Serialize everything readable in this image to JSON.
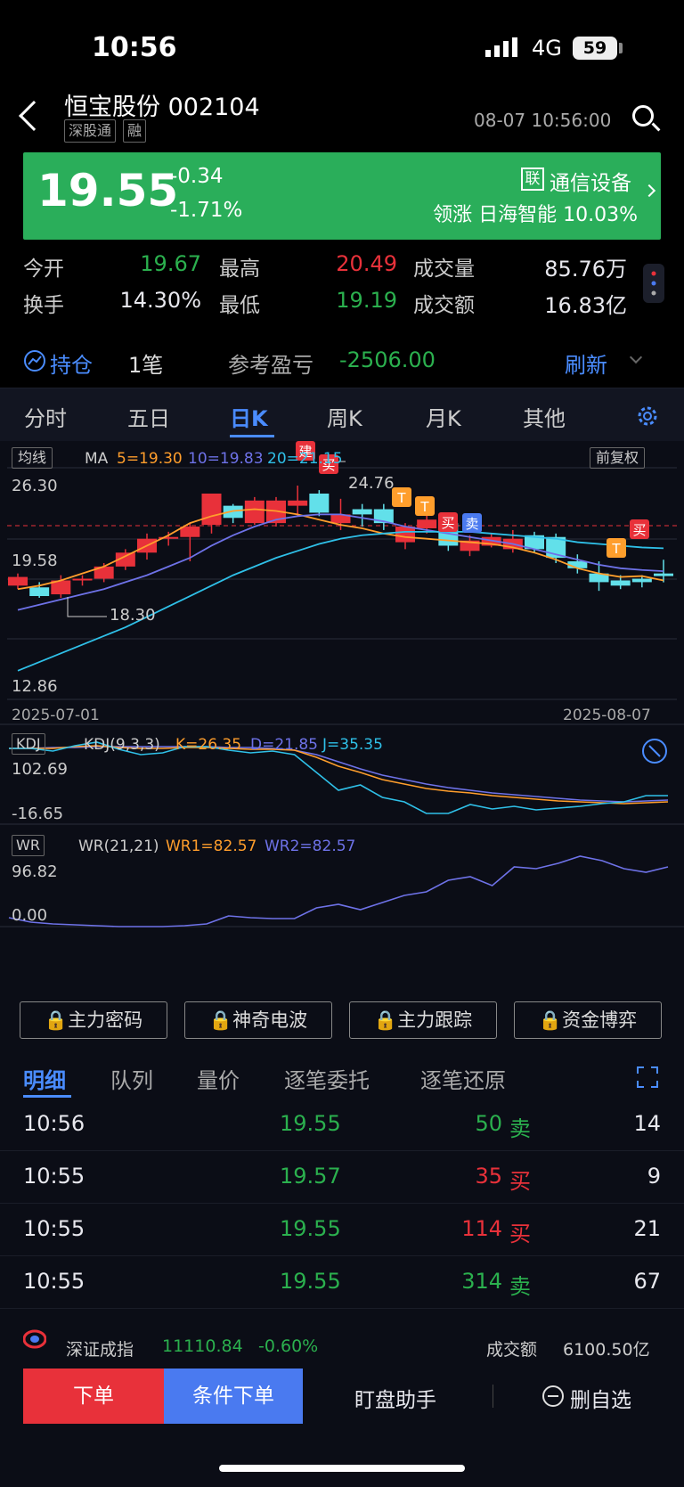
{
  "status": {
    "time": "10:56",
    "network": "4G",
    "battery": "59"
  },
  "header": {
    "name": "恒宝股份 002104",
    "tags": [
      "深股通",
      "融"
    ],
    "datetime": "08-07 10:56:00"
  },
  "quote": {
    "price": "19.55",
    "change": "-0.34",
    "change_pct": "-1.71%",
    "industry_tag": "联",
    "industry": "通信设备",
    "leader": "领涨 日海智能 10.03%",
    "bg_color": "#2aae5a"
  },
  "stats": [
    {
      "label": "今开",
      "value": "19.67",
      "color": "green"
    },
    {
      "label": "最高",
      "value": "20.49",
      "color": "red"
    },
    {
      "label": "成交量",
      "value": "85.76万",
      "color": "white"
    },
    {
      "label": "换手",
      "value": "14.30%",
      "color": "white"
    },
    {
      "label": "最低",
      "value": "19.19",
      "color": "green"
    },
    {
      "label": "成交额",
      "value": "16.83亿",
      "color": "white"
    }
  ],
  "holding": {
    "label": "持仓",
    "count": "1笔",
    "ref_label": "参考盈亏",
    "ref_value": "-2506.00",
    "refresh": "刷新"
  },
  "tabs": [
    "分时",
    "五日",
    "日K",
    "周K",
    "月K",
    "其他"
  ],
  "active_tab": "日K",
  "chart": {
    "ma_selector": "均线",
    "adjust": "前复权",
    "ma_label": "MA",
    "ma5": "5=19.30",
    "ma10": "10=19.83",
    "ma20": "20=21.15",
    "y_top": "26.30",
    "y_mid": "19.58",
    "y_bottom": "12.86",
    "high_mark": "24.76",
    "low_mark": "18.30",
    "x_start": "2025-07-01",
    "x_end": "2025-08-07",
    "kdj_selector": "KDJ",
    "kdj_params": "KDJ(9,3,3)",
    "k": "K=26.35",
    "d": "D=21.85",
    "j": "J=35.35",
    "kdj_top": "102.69",
    "kdj_bottom": "-16.65",
    "wr_selector": "WR",
    "wr_params": "WR(21,21)",
    "wr1": "WR1=82.57",
    "wr2": "WR2=82.57",
    "wr_top": "96.82",
    "wr_bottom": "0.00",
    "signals": {
      "jian": "建",
      "mai": "买",
      "mai2": "卖",
      "t": "T"
    }
  },
  "chart_data": {
    "type": "candlestick",
    "x_start": "2025-07-01",
    "x_end": "2025-08-07",
    "ylim": [
      12.86,
      26.3
    ],
    "candles": [
      [
        19.0,
        19.5,
        19.7,
        18.8
      ],
      [
        18.9,
        18.4,
        19.2,
        18.3
      ],
      [
        18.5,
        19.3,
        19.6,
        18.3
      ],
      [
        19.3,
        19.4,
        19.6,
        19.0
      ],
      [
        19.4,
        20.1,
        20.3,
        19.2
      ],
      [
        20.1,
        20.9,
        21.1,
        19.9
      ],
      [
        20.9,
        21.7,
        22.0,
        20.5
      ],
      [
        21.7,
        21.8,
        22.1,
        21.3
      ],
      [
        21.8,
        22.4,
        22.6,
        20.4
      ],
      [
        22.5,
        24.3,
        24.3,
        22.0
      ],
      [
        23.6,
        22.9,
        23.7,
        22.6
      ],
      [
        22.6,
        23.9,
        24.1,
        22.5
      ],
      [
        22.6,
        23.9,
        24.1,
        22.4
      ],
      [
        23.6,
        23.9,
        24.76,
        23.0
      ],
      [
        24.3,
        23.2,
        24.5,
        23.0
      ],
      [
        22.6,
        23.1,
        24.0,
        22.2
      ],
      [
        23.4,
        23.1,
        23.7,
        22.4
      ],
      [
        23.4,
        22.6,
        23.7,
        22.2
      ],
      [
        21.5,
        22.4,
        22.6,
        21.1
      ],
      [
        22.3,
        22.8,
        23.2,
        22.0
      ],
      [
        22.6,
        21.3,
        22.8,
        21.0
      ],
      [
        21.0,
        21.6,
        21.9,
        20.7
      ],
      [
        21.3,
        21.8,
        22.0,
        21.2
      ],
      [
        21.1,
        21.7,
        22.2,
        20.9
      ],
      [
        21.9,
        21.1,
        22.1,
        20.9
      ],
      [
        21.8,
        20.6,
        22.0,
        20.3
      ],
      [
        20.4,
        20.0,
        20.8,
        19.7
      ],
      [
        19.7,
        19.2,
        20.4,
        18.7
      ],
      [
        19.3,
        19.0,
        19.6,
        18.8
      ],
      [
        19.4,
        19.2,
        19.6,
        18.9
      ],
      [
        19.7,
        19.55,
        20.49,
        19.19
      ]
    ],
    "ma5": [
      18.8,
      19.0,
      19.3,
      19.7,
      20.1,
      20.7,
      21.3,
      21.9,
      22.6,
      23.0,
      23.3,
      23.4,
      23.3,
      23.1,
      22.8,
      22.5,
      22.3,
      22.0,
      21.8,
      21.7,
      21.6,
      21.5,
      21.4,
      21.2,
      20.9,
      20.5,
      20.0,
      19.7,
      19.5,
      19.55,
      19.3
    ],
    "ma10": [
      17.6,
      17.9,
      18.2,
      18.5,
      18.8,
      19.2,
      19.6,
      20.1,
      20.6,
      21.3,
      21.9,
      22.4,
      22.8,
      23.0,
      23.1,
      23.1,
      22.9,
      22.7,
      22.4,
      22.2,
      22.0,
      21.8,
      21.6,
      21.4,
      21.1,
      20.8,
      20.5,
      20.2,
      20.0,
      19.9,
      19.83
    ],
    "ma20": [
      14.1,
      14.6,
      15.1,
      15.6,
      16.1,
      16.6,
      17.2,
      17.8,
      18.4,
      19.0,
      19.6,
      20.1,
      20.6,
      21.0,
      21.4,
      21.7,
      21.9,
      22.0,
      22.1,
      22.1,
      22.1,
      22.1,
      22.0,
      21.9,
      21.8,
      21.7,
      21.5,
      21.4,
      21.3,
      21.2,
      21.15
    ]
  },
  "locks": [
    "主力密码",
    "神奇电波",
    "主力跟踪",
    "资金博弈"
  ],
  "detail_tabs": [
    "明细",
    "队列",
    "量价",
    "逐笔委托",
    "逐笔还原"
  ],
  "trades": [
    {
      "time": "10:56",
      "price": "19.55",
      "vol": "50",
      "side": "卖",
      "count": "14",
      "price_color": "green",
      "side_color": "green"
    },
    {
      "time": "10:55",
      "price": "19.57",
      "vol": "35",
      "side": "买",
      "count": "9",
      "price_color": "green",
      "side_color": "red"
    },
    {
      "time": "10:55",
      "price": "19.55",
      "vol": "114",
      "side": "买",
      "count": "21",
      "price_color": "green",
      "side_color": "red"
    },
    {
      "time": "10:55",
      "price": "19.55",
      "vol": "314",
      "side": "卖",
      "count": "67",
      "price_color": "green",
      "side_color": "green"
    }
  ],
  "ticker": {
    "name": "深证成指",
    "value": "11110.84",
    "pct": "-0.60%",
    "amt_label": "成交额",
    "amt": "6100.50亿"
  },
  "bottom": {
    "order": "下单",
    "cond_order": "条件下单",
    "assist": "盯盘助手",
    "remove": "删自选"
  }
}
